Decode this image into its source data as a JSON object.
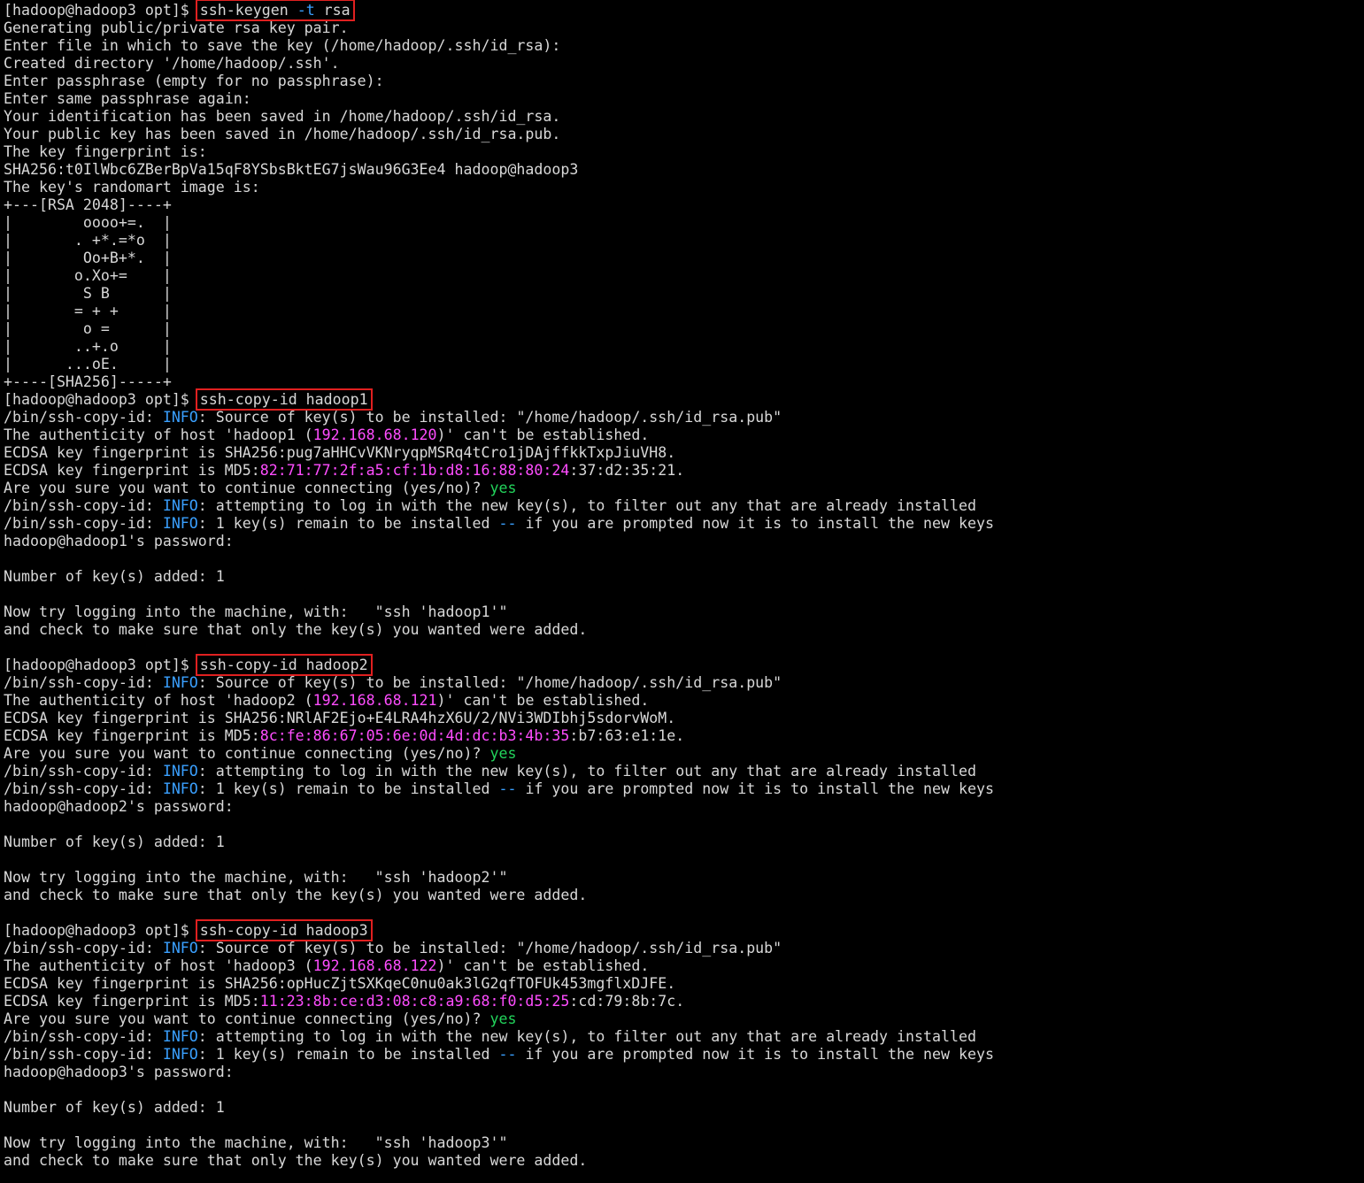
{
  "terminal": {
    "colors": {
      "background": "#000000",
      "text": "#d8d8d8",
      "info": "#3aa0ff",
      "ip_and_md5": "#ff4dff",
      "yes": "#22d45b",
      "highlight_box": "#e02020"
    },
    "lines": [
      [
        {
          "t": "[hadoop@hadoop3 opt]$ "
        },
        {
          "t": "ssh-keygen ",
          "box": true
        },
        {
          "t": "-t",
          "c": "blue",
          "box": true
        },
        {
          "t": " rsa",
          "box": true
        }
      ],
      [
        {
          "t": "Generating public/private rsa key pair."
        }
      ],
      [
        {
          "t": "Enter file in which to save the key (/home/hadoop/.ssh/id_rsa):"
        }
      ],
      [
        {
          "t": "Created directory '/home/hadoop/.ssh'."
        }
      ],
      [
        {
          "t": "Enter passphrase (empty for no passphrase):"
        }
      ],
      [
        {
          "t": "Enter same passphrase again:"
        }
      ],
      [
        {
          "t": "Your identification has been saved in /home/hadoop/.ssh/id_rsa."
        }
      ],
      [
        {
          "t": "Your public key has been saved in /home/hadoop/.ssh/id_rsa.pub."
        }
      ],
      [
        {
          "t": "The key fingerprint is:"
        }
      ],
      [
        {
          "t": "SHA256:t0IlWbc6ZBerBpVa15qF8YSbsBktEG7jsWau96G3Ee4 hadoop@hadoop3"
        }
      ],
      [
        {
          "t": "The key's randomart image is:"
        }
      ],
      [
        {
          "t": "+---[RSA 2048]----+"
        }
      ],
      [
        {
          "t": "|        oooo+=.  |"
        }
      ],
      [
        {
          "t": "|       . +*.=*o  |"
        }
      ],
      [
        {
          "t": "|        Oo+B+*.  |"
        }
      ],
      [
        {
          "t": "|       o.Xo+=    |"
        }
      ],
      [
        {
          "t": "|        S B      |"
        }
      ],
      [
        {
          "t": "|       = + +     |"
        }
      ],
      [
        {
          "t": "|        o =      |"
        }
      ],
      [
        {
          "t": "|       ..+.o     |"
        }
      ],
      [
        {
          "t": "|      ...oE.     |"
        }
      ],
      [
        {
          "t": "+----[SHA256]-----+"
        }
      ],
      [
        {
          "t": "[hadoop@hadoop3 opt]$ "
        },
        {
          "t": "ssh-copy-id hadoop1",
          "box": true
        }
      ],
      [
        {
          "t": "/bin/ssh-copy-id: "
        },
        {
          "t": "INFO",
          "c": "blue"
        },
        {
          "t": ": Source of key(s) to be installed: \"/home/hadoop/.ssh/id_rsa.pub\""
        }
      ],
      [
        {
          "t": "The authenticity of host 'hadoop1 ("
        },
        {
          "t": "192.168.68.120",
          "c": "magenta"
        },
        {
          "t": ")' can't be established."
        }
      ],
      [
        {
          "t": "ECDSA key fingerprint is SHA256:pug7aHHCvVKNryqpMSRq4tCro1jDAjffkkTxpJiuVH8."
        }
      ],
      [
        {
          "t": "ECDSA key fingerprint is MD5:"
        },
        {
          "t": "82:71:77:2f:a5:cf:1b:d8:16:88:80:24",
          "c": "magenta"
        },
        {
          "t": ":37:d2:35:21."
        }
      ],
      [
        {
          "t": "Are you sure you want to continue connecting (yes/no)? "
        },
        {
          "t": "yes",
          "c": "green"
        }
      ],
      [
        {
          "t": "/bin/ssh-copy-id: "
        },
        {
          "t": "INFO",
          "c": "blue"
        },
        {
          "t": ": attempting to log in with the new key(s), to filter out any that are already installed"
        }
      ],
      [
        {
          "t": "/bin/ssh-copy-id: "
        },
        {
          "t": "INFO",
          "c": "blue"
        },
        {
          "t": ": 1 key(s) remain to be installed "
        },
        {
          "t": "--",
          "c": "blue"
        },
        {
          "t": " if you are prompted now it is to install the new keys"
        }
      ],
      [
        {
          "t": "hadoop@hadoop1's password:"
        }
      ],
      [
        {
          "t": ""
        }
      ],
      [
        {
          "t": "Number of key(s) added: 1"
        }
      ],
      [
        {
          "t": ""
        }
      ],
      [
        {
          "t": "Now try logging into the machine, with:   \"ssh 'hadoop1'\""
        }
      ],
      [
        {
          "t": "and check to make sure that only the key(s) you wanted were added."
        }
      ],
      [
        {
          "t": ""
        }
      ],
      [
        {
          "t": "[hadoop@hadoop3 opt]$ "
        },
        {
          "t": "ssh-copy-id hadoop2",
          "box": true
        }
      ],
      [
        {
          "t": "/bin/ssh-copy-id: "
        },
        {
          "t": "INFO",
          "c": "blue"
        },
        {
          "t": ": Source of key(s) to be installed: \"/home/hadoop/.ssh/id_rsa.pub\""
        }
      ],
      [
        {
          "t": "The authenticity of host 'hadoop2 ("
        },
        {
          "t": "192.168.68.121",
          "c": "magenta"
        },
        {
          "t": ")' can't be established."
        }
      ],
      [
        {
          "t": "ECDSA key fingerprint is SHA256:NRlAF2Ejo+E4LRA4hzX6U/2/NVi3WDIbhj5sdorvWoM."
        }
      ],
      [
        {
          "t": "ECDSA key fingerprint is MD5:"
        },
        {
          "t": "8c:fe:86:67:05:6e:0d:4d:dc:b3:4b:35",
          "c": "magenta"
        },
        {
          "t": ":b7:63:e1:1e."
        }
      ],
      [
        {
          "t": "Are you sure you want to continue connecting (yes/no)? "
        },
        {
          "t": "yes",
          "c": "green"
        }
      ],
      [
        {
          "t": "/bin/ssh-copy-id: "
        },
        {
          "t": "INFO",
          "c": "blue"
        },
        {
          "t": ": attempting to log in with the new key(s), to filter out any that are already installed"
        }
      ],
      [
        {
          "t": "/bin/ssh-copy-id: "
        },
        {
          "t": "INFO",
          "c": "blue"
        },
        {
          "t": ": 1 key(s) remain to be installed "
        },
        {
          "t": "--",
          "c": "blue"
        },
        {
          "t": " if you are prompted now it is to install the new keys"
        }
      ],
      [
        {
          "t": "hadoop@hadoop2's password:"
        }
      ],
      [
        {
          "t": ""
        }
      ],
      [
        {
          "t": "Number of key(s) added: 1"
        }
      ],
      [
        {
          "t": ""
        }
      ],
      [
        {
          "t": "Now try logging into the machine, with:   \"ssh 'hadoop2'\""
        }
      ],
      [
        {
          "t": "and check to make sure that only the key(s) you wanted were added."
        }
      ],
      [
        {
          "t": ""
        }
      ],
      [
        {
          "t": "[hadoop@hadoop3 opt]$ "
        },
        {
          "t": "ssh-copy-id hadoop3",
          "box": true
        }
      ],
      [
        {
          "t": "/bin/ssh-copy-id: "
        },
        {
          "t": "INFO",
          "c": "blue"
        },
        {
          "t": ": Source of key(s) to be installed: \"/home/hadoop/.ssh/id_rsa.pub\""
        }
      ],
      [
        {
          "t": "The authenticity of host 'hadoop3 ("
        },
        {
          "t": "192.168.68.122",
          "c": "magenta"
        },
        {
          "t": ")' can't be established."
        }
      ],
      [
        {
          "t": "ECDSA key fingerprint is SHA256:opHucZjtSXKqeC0nu0ak3lG2qfTOFUk453mgflxDJFE."
        }
      ],
      [
        {
          "t": "ECDSA key fingerprint is MD5:"
        },
        {
          "t": "11:23:8b:ce:d3:08:c8:a9:68:f0:d5:25",
          "c": "magenta"
        },
        {
          "t": ":cd:79:8b:7c."
        }
      ],
      [
        {
          "t": "Are you sure you want to continue connecting (yes/no)? "
        },
        {
          "t": "yes",
          "c": "green"
        }
      ],
      [
        {
          "t": "/bin/ssh-copy-id: "
        },
        {
          "t": "INFO",
          "c": "blue"
        },
        {
          "t": ": attempting to log in with the new key(s), to filter out any that are already installed"
        }
      ],
      [
        {
          "t": "/bin/ssh-copy-id: "
        },
        {
          "t": "INFO",
          "c": "blue"
        },
        {
          "t": ": 1 key(s) remain to be installed "
        },
        {
          "t": "--",
          "c": "blue"
        },
        {
          "t": " if you are prompted now it is to install the new keys"
        }
      ],
      [
        {
          "t": "hadoop@hadoop3's password:"
        }
      ],
      [
        {
          "t": ""
        }
      ],
      [
        {
          "t": "Number of key(s) added: 1"
        }
      ],
      [
        {
          "t": ""
        }
      ],
      [
        {
          "t": "Now try logging into the machine, with:   \"ssh 'hadoop3'\""
        }
      ],
      [
        {
          "t": "and check to make sure that only the key(s) you wanted were added."
        }
      ]
    ]
  }
}
